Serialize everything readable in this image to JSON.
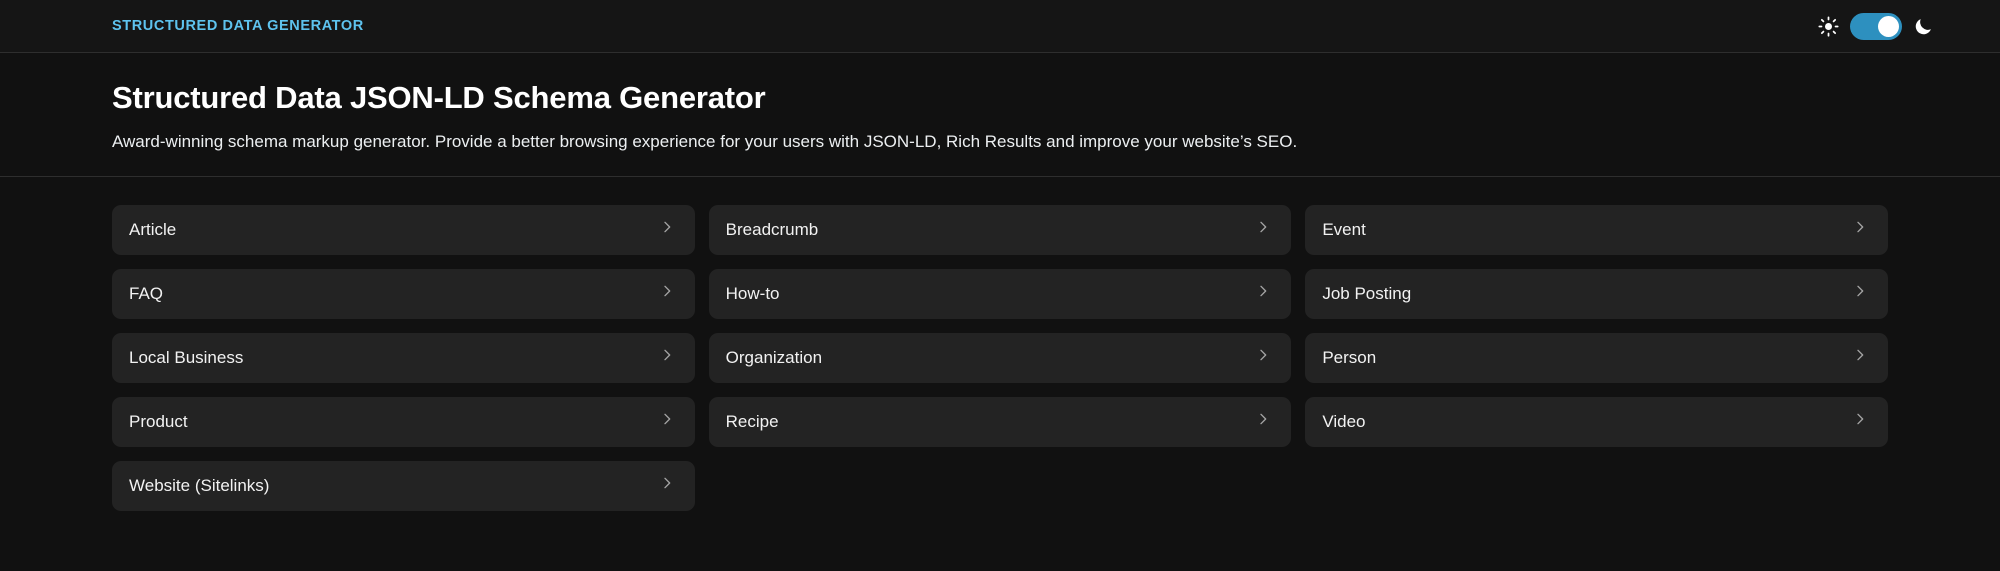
{
  "header": {
    "brand": "Structured Data Generator",
    "theme_toggle": {
      "light_icon": "sun-icon",
      "dark_icon": "moon-icon",
      "state": "dark",
      "accent_color": "#2d90bf",
      "knob_color": "#ffffff"
    }
  },
  "hero": {
    "title": "Structured Data JSON-LD Schema Generator",
    "subtitle": "Award-winning schema markup generator. Provide a better browsing experience for your users with JSON-LD, Rich Results and improve your website’s SEO."
  },
  "schema_cards": [
    {
      "label": "Article",
      "chevron": "chevron-right-icon"
    },
    {
      "label": "Breadcrumb",
      "chevron": "chevron-right-icon"
    },
    {
      "label": "Event",
      "chevron": "chevron-right-icon"
    },
    {
      "label": "FAQ",
      "chevron": "chevron-right-icon"
    },
    {
      "label": "How-to",
      "chevron": "chevron-right-icon"
    },
    {
      "label": "Job Posting",
      "chevron": "chevron-right-icon"
    },
    {
      "label": "Local Business",
      "chevron": "chevron-right-icon"
    },
    {
      "label": "Organization",
      "chevron": "chevron-right-icon"
    },
    {
      "label": "Person",
      "chevron": "chevron-right-icon"
    },
    {
      "label": "Product",
      "chevron": "chevron-right-icon"
    },
    {
      "label": "Recipe",
      "chevron": "chevron-right-icon"
    },
    {
      "label": "Video",
      "chevron": "chevron-right-icon"
    },
    {
      "label": "Website (Sitelinks)",
      "chevron": "chevron-right-icon"
    }
  ],
  "colors": {
    "page_background": "#111111",
    "topbar_background": "#151515",
    "card_background": "#232323",
    "brand_accent": "#5ec3ee",
    "divider": "#2e2e2e",
    "text_primary": "#ffffff"
  }
}
